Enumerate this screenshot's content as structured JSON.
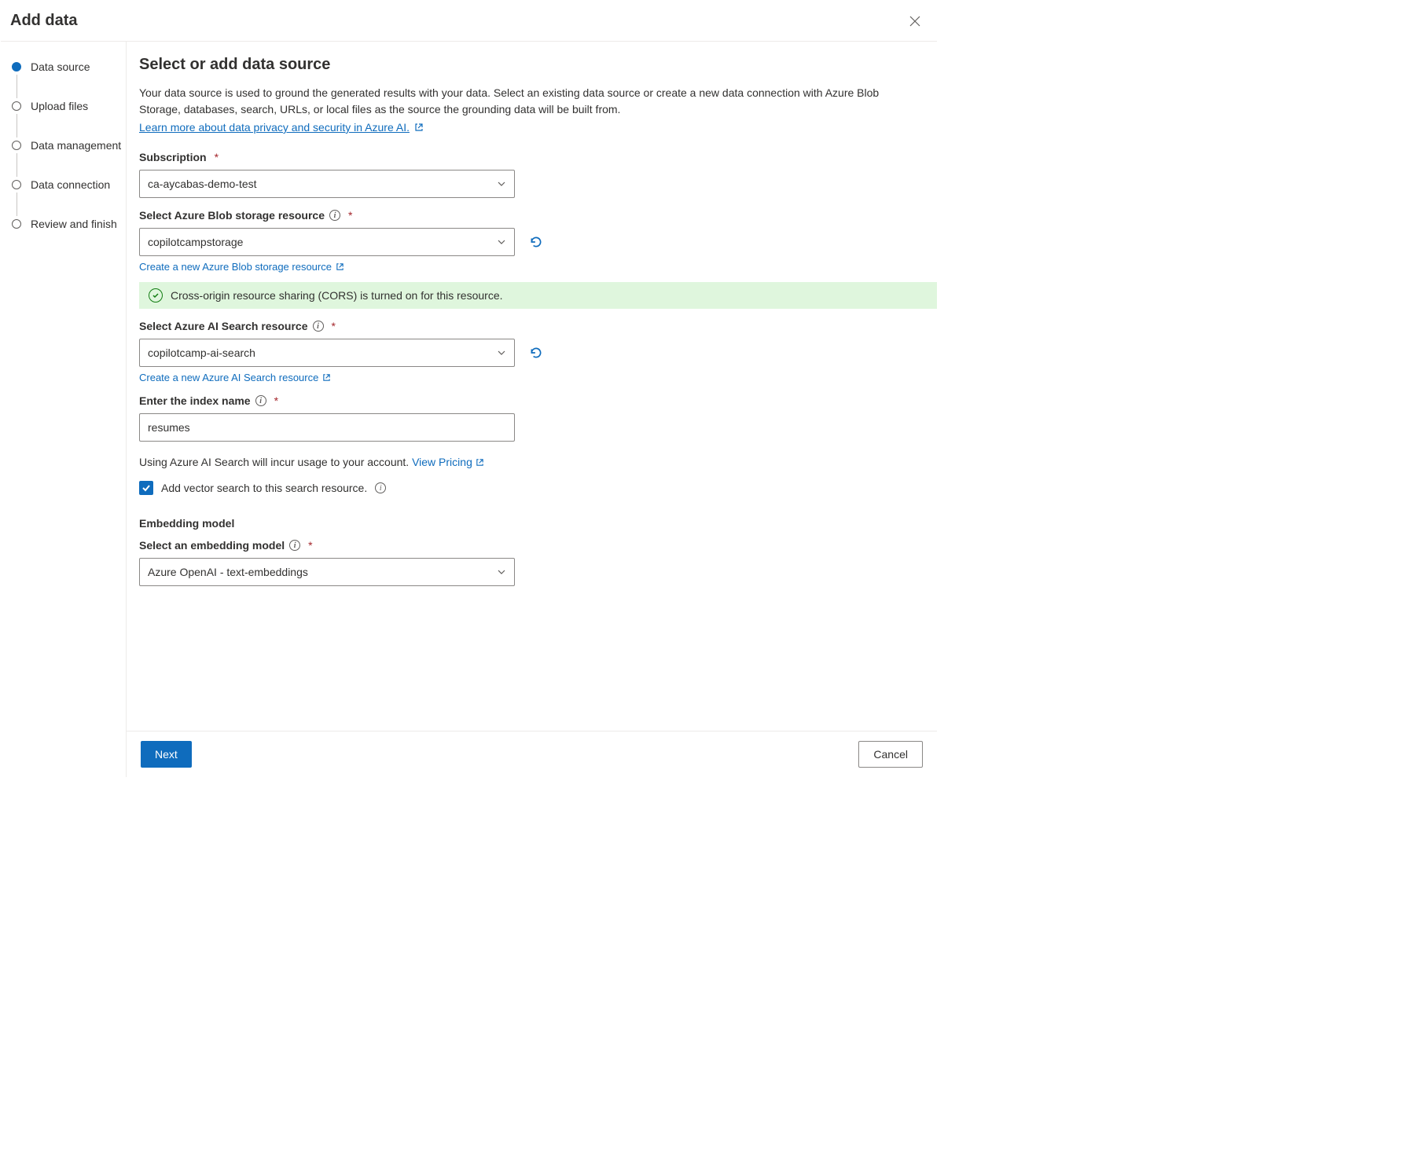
{
  "dialog": {
    "title": "Add data"
  },
  "steps": [
    {
      "label": "Data source",
      "active": true
    },
    {
      "label": "Upload files",
      "active": false
    },
    {
      "label": "Data management",
      "active": false
    },
    {
      "label": "Data connection",
      "active": false
    },
    {
      "label": "Review and finish",
      "active": false
    }
  ],
  "page": {
    "title": "Select or add data source",
    "desc": "Your data source is used to ground the generated results with your data. Select an existing data source or create a new data connection with Azure Blob Storage, databases, search, URLs, or local files as the source the grounding data will be built from.",
    "learn_link": "Learn more about data privacy and security in Azure AI."
  },
  "fields": {
    "subscription": {
      "label": "Subscription",
      "value": "ca-aycabas-demo-test"
    },
    "blob": {
      "label": "Select Azure Blob storage resource",
      "value": "copilotcampstorage",
      "create_link": "Create a new Azure Blob storage resource"
    },
    "cors_banner": "Cross-origin resource sharing (CORS) is turned on for this resource.",
    "search": {
      "label": "Select Azure AI Search resource",
      "value": "copilotcamp-ai-search",
      "create_link": "Create a new Azure AI Search resource"
    },
    "index": {
      "label": "Enter the index name",
      "value": "resumes"
    },
    "pricing_text": "Using Azure AI Search will incur usage to your account. ",
    "pricing_link": "View Pricing",
    "vector_checkbox": "Add vector search to this search resource.",
    "embedding_section": "Embedding model",
    "embedding": {
      "label": "Select an embedding model",
      "value": "Azure OpenAI - text-embeddings"
    }
  },
  "footer": {
    "next": "Next",
    "cancel": "Cancel"
  }
}
